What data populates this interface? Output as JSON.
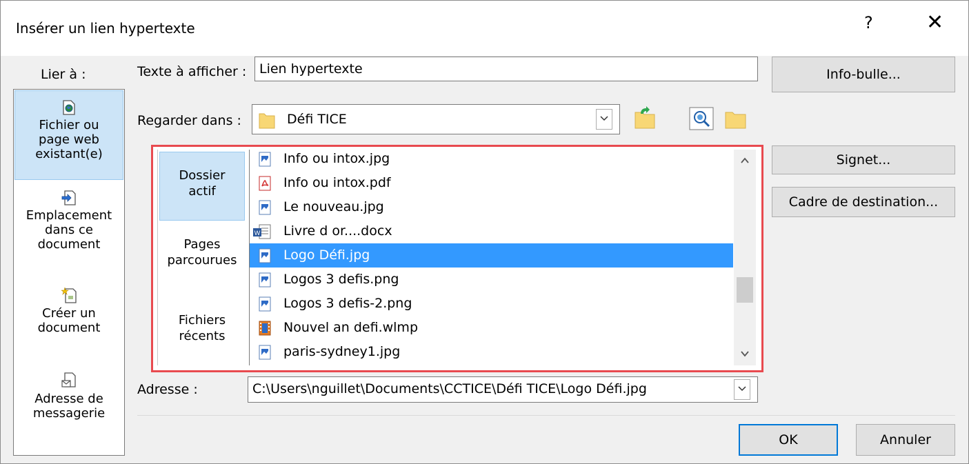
{
  "window": {
    "title": "Insérer un lien hypertexte",
    "help_label": "?",
    "close_label": "✕"
  },
  "link_to": {
    "label": "Lier à :",
    "items": [
      {
        "line1": "Fichier ou",
        "line2": "page web",
        "line3": "existant(e)",
        "icon": "web-file-icon",
        "active": true
      },
      {
        "line1": "Emplacement",
        "line2": "dans ce",
        "line3": "document",
        "icon": "document-place-icon",
        "active": false
      },
      {
        "line1": "Créer un",
        "line2": "document",
        "line3": "",
        "icon": "new-document-icon",
        "active": false
      },
      {
        "line1": "Adresse de",
        "line2": "messagerie",
        "line3": "",
        "icon": "email-icon",
        "active": false
      }
    ]
  },
  "display_text": {
    "label": "Texte à afficher :",
    "value": "Lien hypertexte"
  },
  "tooltip_button": "Info-bulle...",
  "look_in": {
    "label": "Regarder dans :",
    "value": "Défi TICE",
    "icon": "folder-icon"
  },
  "toolbar_icons": [
    "up-folder-icon",
    "browse-web-icon",
    "browse-file-icon"
  ],
  "places": [
    {
      "line1": "Dossier",
      "line2": "actif",
      "active": true
    },
    {
      "line1": "Pages",
      "line2": "parcourues",
      "active": false
    },
    {
      "line1": "Fichiers",
      "line2": "récents",
      "active": false
    }
  ],
  "files": [
    {
      "name": "Info ou intox.jpg",
      "type": "image",
      "selected": false
    },
    {
      "name": "Info ou intox.pdf",
      "type": "pdf",
      "selected": false
    },
    {
      "name": "Le nouveau.jpg",
      "type": "image",
      "selected": false
    },
    {
      "name": "Livre d or....docx",
      "type": "word",
      "selected": false
    },
    {
      "name": "Logo Défi.jpg",
      "type": "image",
      "selected": true
    },
    {
      "name": "Logos 3 defis.png",
      "type": "image",
      "selected": false
    },
    {
      "name": "Logos 3 defis-2.png",
      "type": "image",
      "selected": false
    },
    {
      "name": "Nouvel an defi.wlmp",
      "type": "movie",
      "selected": false
    },
    {
      "name": "paris-sydney1.jpg",
      "type": "image",
      "selected": false
    }
  ],
  "bookmark_button": "Signet...",
  "target_frame_button": "Cadre de destination...",
  "address": {
    "label": "Adresse :",
    "value": "C:\\Users\\nguillet\\Documents\\CCTICE\\Défi TICE\\Logo Défi.jpg"
  },
  "ok_button": "OK",
  "cancel_button": "Annuler",
  "colors": {
    "selection": "#3399ff",
    "nav_active": "#cce4f7",
    "highlight_border": "#e84a4f",
    "default_button_border": "#0078d7"
  }
}
